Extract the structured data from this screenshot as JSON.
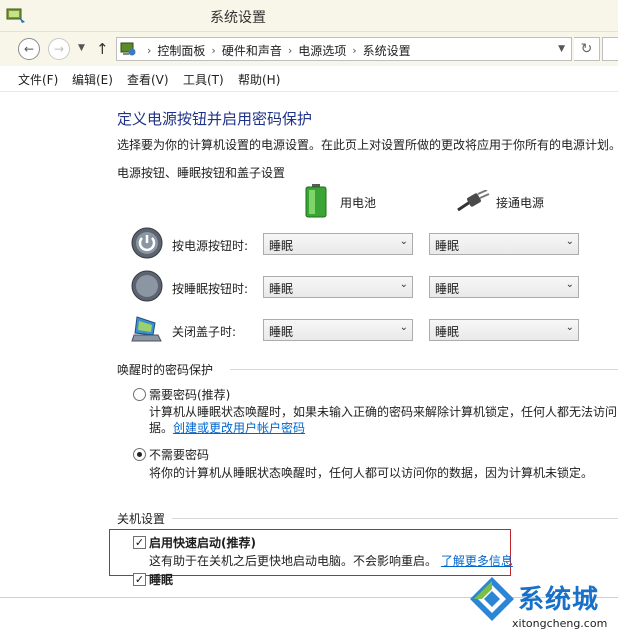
{
  "window": {
    "title": "系统设置"
  },
  "address_bar": {
    "crumbs": [
      "控制面板",
      "硬件和声音",
      "电源选项",
      "系统设置"
    ],
    "separator": "›"
  },
  "menu": [
    "文件(F)",
    "编辑(E)",
    "查看(V)",
    "工具(T)",
    "帮助(H)"
  ],
  "page": {
    "heading": "定义电源按钮并启用密码保护",
    "description": "选择要为你的计算机设置的电源设置。在此页上对设置所做的更改将应用于你所有的电源计划。",
    "power_section_title": "电源按钮、睡眠按钮和盖子设置",
    "columns": {
      "battery": "用电池",
      "plugged": "接通电源"
    },
    "rows": [
      {
        "label": "按电源按钮时:",
        "icon": "power-button-icon",
        "battery": "睡眠",
        "plugged": "睡眠"
      },
      {
        "label": "按睡眠按钮时:",
        "icon": "sleep-button-icon",
        "battery": "睡眠",
        "plugged": "睡眠"
      },
      {
        "label": "关闭盖子时:",
        "icon": "laptop-lid-icon",
        "battery": "睡眠",
        "plugged": "睡眠"
      }
    ],
    "wake_section_title": "唤醒时的密码保护",
    "wake_options": [
      {
        "label": "需要密码(推荐)",
        "checked": false,
        "desc1": "计算机从睡眠状态唤醒时，如果未输入正确的密码来解除计算机锁定，任何人都无法访问",
        "desc2_prefix": "据。",
        "link": "创建或更改用户帐户密码"
      },
      {
        "label": "不需要密码",
        "checked": true,
        "desc1": "将你的计算机从睡眠状态唤醒时，任何人都可以访问你的数据，因为计算机未锁定。"
      }
    ],
    "shutdown_section_title": "关机设置",
    "fast_startup": {
      "label": "启用快速启动(推荐)",
      "checked": true,
      "desc": "这有助于在关机之后更快地启动电脑。不会影响重启。",
      "link": "了解更多信息"
    },
    "sleep": {
      "label": "睡眠",
      "checked": true
    }
  },
  "watermark": {
    "brand": "系统城",
    "url": "xitongcheng.com"
  },
  "colors": {
    "heading": "#1e3287",
    "link": "#0066cc",
    "highlight": "#c0272d",
    "watermark": "#1870c8"
  }
}
